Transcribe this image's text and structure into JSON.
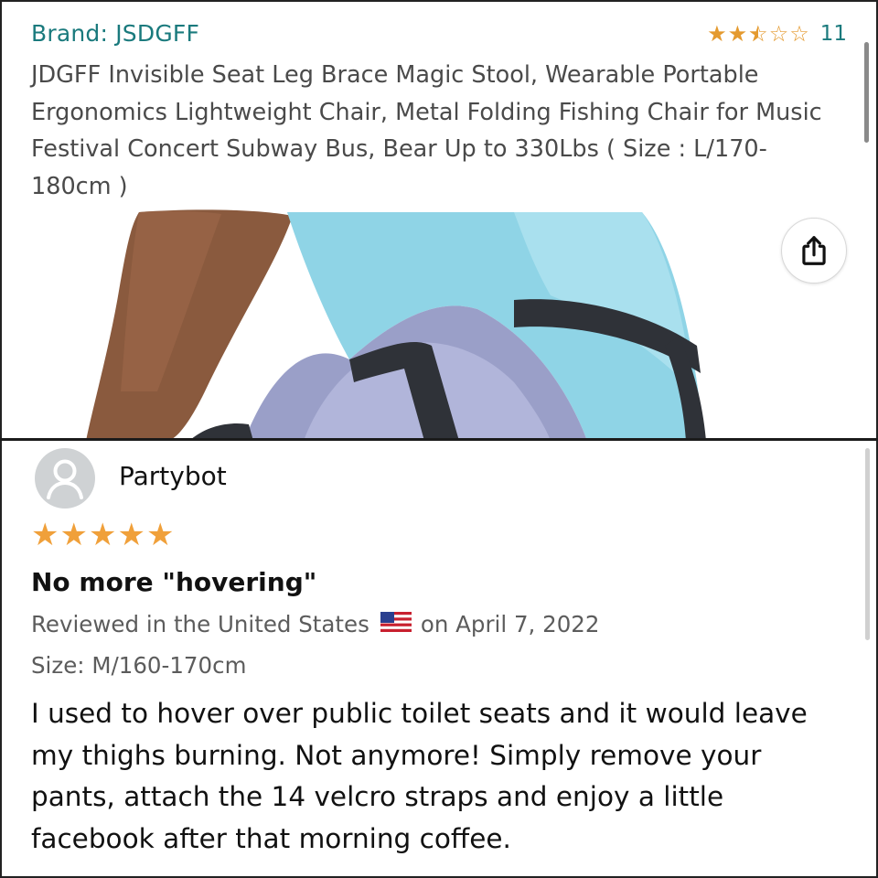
{
  "product": {
    "brand_link": "Brand: JSDGFF",
    "rating": {
      "value": 2.5,
      "max": 5,
      "count": "11"
    },
    "title": "JDGFF Invisible Seat Leg Brace Magic Stool, Wearable Portable Ergonomics Lightweight Chair, Metal Folding Fishing Chair for Music Festival Concert Subway Bus, Bear Up to 330Lbs ( Size : L/170-180cm )",
    "share_icon": "share-icon"
  },
  "review": {
    "reviewer": "Partybot",
    "avatar_icon": "user-avatar-icon",
    "stars": 5,
    "title": "No more \"hovering\"",
    "meta_prefix": "Reviewed in the United States",
    "flag_icon": "us-flag-icon",
    "meta_suffix": "on April 7, 2022",
    "size": "Size: M/160-170cm",
    "body": "I used to hover over public toilet seats and it would leave my thighs burning. Not anymore! Simply remove your pants, attach the 14 velcro straps and enjoy a little facebook after that morning coffee."
  },
  "colors": {
    "link": "#1a7a7d",
    "star_top": "#e49a2f",
    "star_review": "#f0a03a",
    "meta_text": "#5c5c5c"
  }
}
